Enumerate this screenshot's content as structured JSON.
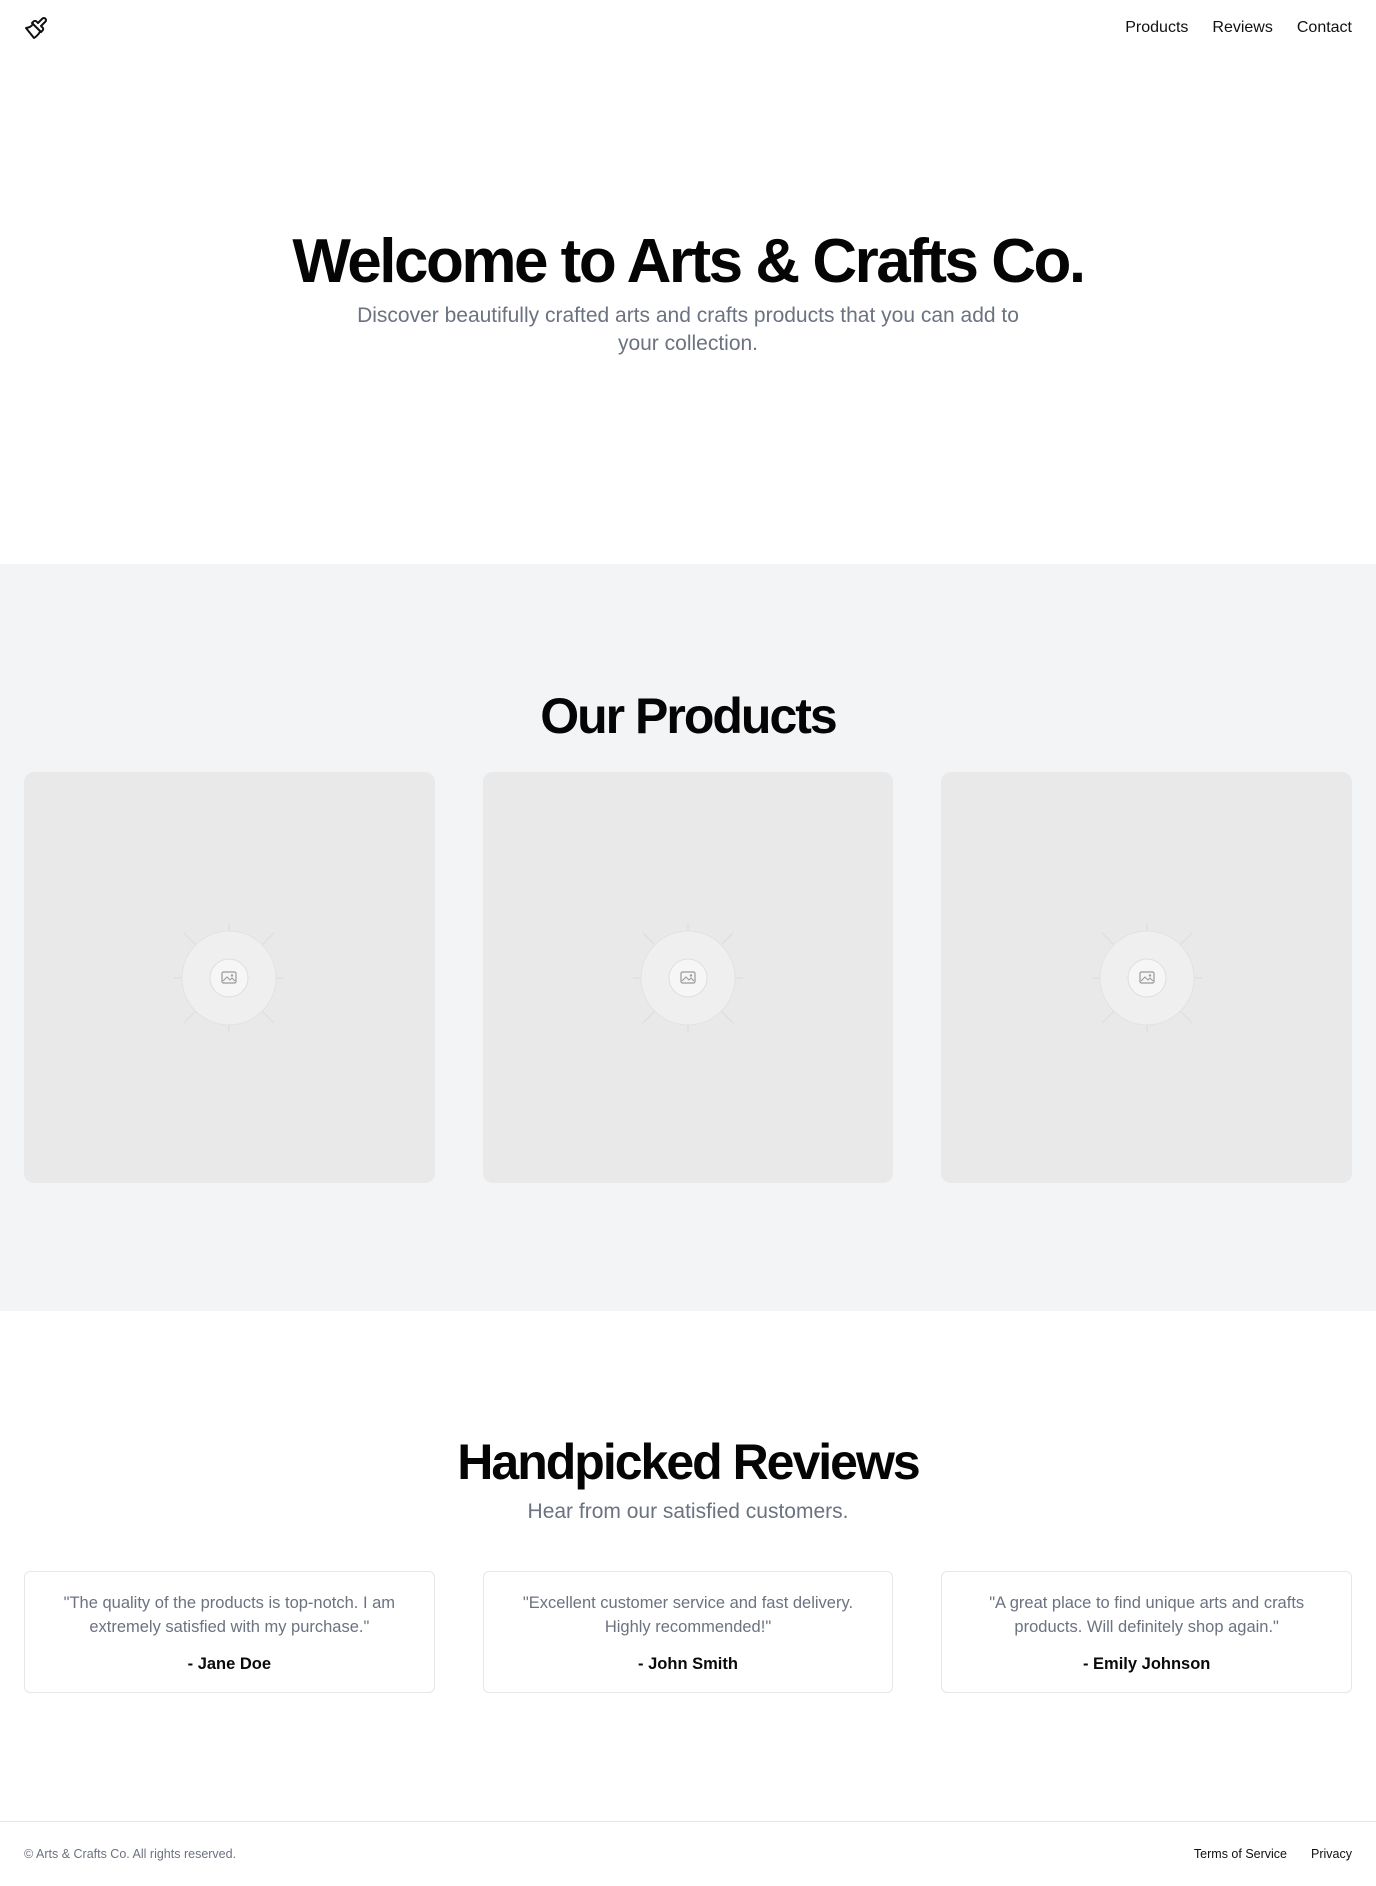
{
  "header": {
    "logo_icon": "paintbrush-icon",
    "nav": [
      {
        "label": "Products"
      },
      {
        "label": "Reviews"
      },
      {
        "label": "Contact"
      }
    ]
  },
  "hero": {
    "title": "Welcome to Arts & Crafts Co.",
    "subtitle": "Discover beautifully crafted arts and crafts products that you can add to your collection."
  },
  "products": {
    "title": "Our Products",
    "items": [
      {
        "image_icon": "image-placeholder-icon"
      },
      {
        "image_icon": "image-placeholder-icon"
      },
      {
        "image_icon": "image-placeholder-icon"
      }
    ]
  },
  "reviews": {
    "title": "Handpicked Reviews",
    "subtitle": "Hear from our satisfied customers.",
    "items": [
      {
        "quote": "\"The quality of the products is top-notch. I am extremely satisfied with my purchase.\"",
        "author": "- Jane Doe"
      },
      {
        "quote": "\"Excellent customer service and fast delivery. Highly recommended!\"",
        "author": "- John Smith"
      },
      {
        "quote": "\"A great place to find unique arts and crafts products. Will definitely shop again.\"",
        "author": "- Emily Johnson"
      }
    ]
  },
  "footer": {
    "copyright": "© Arts & Crafts Co. All rights reserved.",
    "links": [
      {
        "label": "Terms of Service"
      },
      {
        "label": "Privacy"
      }
    ]
  },
  "colors": {
    "products_bg": "#f3f4f6",
    "card_bg": "#e9e9e9",
    "muted_text": "#6b7280",
    "border": "#e5e7eb"
  }
}
